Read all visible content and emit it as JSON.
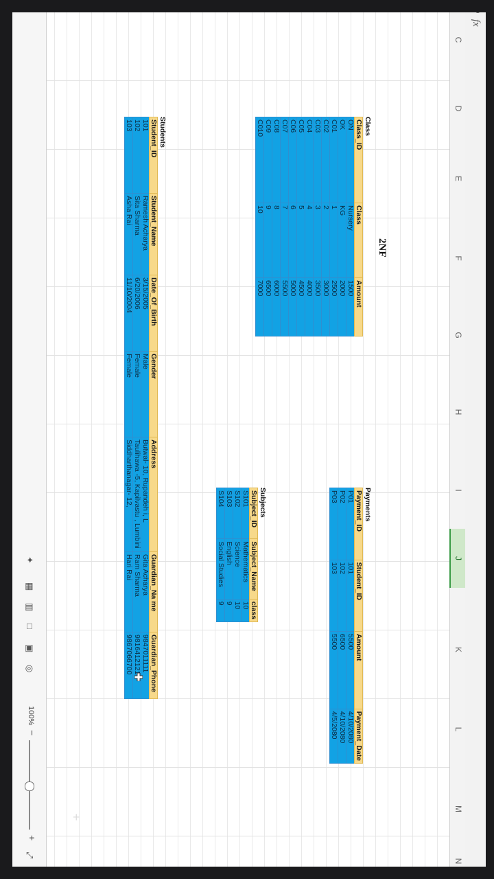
{
  "toolbar": {
    "fx_label": "fx",
    "zoom_icon": "magnifier-icon"
  },
  "columns": [
    {
      "letter": "C"
    },
    {
      "letter": "D"
    },
    {
      "letter": "E"
    },
    {
      "letter": "F"
    },
    {
      "letter": "G"
    },
    {
      "letter": "H"
    },
    {
      "letter": "I"
    },
    {
      "letter": "J",
      "selected": true
    },
    {
      "letter": "K"
    },
    {
      "letter": "L"
    },
    {
      "letter": "M"
    },
    {
      "letter": "N"
    }
  ],
  "heading": "2NF",
  "class_table": {
    "title": "Class",
    "headers": [
      "Class_ID",
      "Class",
      "Amount"
    ],
    "rows": [
      [
        "ON",
        "Nursery",
        "1500"
      ],
      [
        "OK",
        "KG",
        "2000"
      ],
      [
        "C01",
        "1",
        "2500"
      ],
      [
        "C02",
        "2",
        "3000"
      ],
      [
        "C03",
        "3",
        "3500"
      ],
      [
        "C04",
        "4",
        "4000"
      ],
      [
        "C05",
        "5",
        "4500"
      ],
      [
        "C06",
        "6",
        "5000"
      ],
      [
        "C07",
        "7",
        "5500"
      ],
      [
        "C08",
        "8",
        "6000"
      ],
      [
        "C09",
        "9",
        "6500"
      ],
      [
        "C010",
        "10",
        "7000"
      ]
    ]
  },
  "payments_table": {
    "title": "Payments",
    "headers": [
      "Payment_ID",
      "Student_ID",
      "Amount",
      "Payment_Date"
    ],
    "rows": [
      [
        "P01",
        "101",
        "5500",
        "4/10/2080"
      ],
      [
        "P02",
        "102",
        "6500",
        "4/10/2080"
      ],
      [
        "P03",
        "103",
        "5500",
        "4/5/2080"
      ]
    ]
  },
  "subjects_table": {
    "title": "Subjects",
    "headers": [
      "Subject_ID",
      "Subject_Name",
      "class"
    ],
    "rows": [
      [
        "S101",
        "Mathematics",
        "10"
      ],
      [
        "S102",
        "Science",
        "10"
      ],
      [
        "S103",
        "English",
        "9"
      ],
      [
        "S104",
        "Social Studies",
        "9"
      ]
    ]
  },
  "students_table": {
    "title": "Students",
    "headers": [
      "Student_ID",
      "Student_Name",
      "Date_Of_Birth",
      "Gender",
      "Address",
      "Guardian_Na me",
      "Guardian_Phone"
    ],
    "rows": [
      [
        "101",
        "Ramesh Acharya",
        "3/15/2005",
        "Male",
        "Butwal- 10, Rupandeh i, L",
        "Gita Acharya",
        "9847011111"
      ],
      [
        "102",
        "Sita Sharma",
        "6/20/2006",
        "Female",
        "Taulihawa -5, Kapilvastu , Lumbini",
        "Ram Sharma",
        "9816412121"
      ],
      [
        "103",
        "Asha Rai",
        "11/10/2004",
        "Female",
        "Siddharthanagar- 12,",
        "Hari Rai",
        "9867066700"
      ]
    ]
  },
  "status_bar": {
    "zoom": "100%",
    "zoom_level_percent": 100
  }
}
